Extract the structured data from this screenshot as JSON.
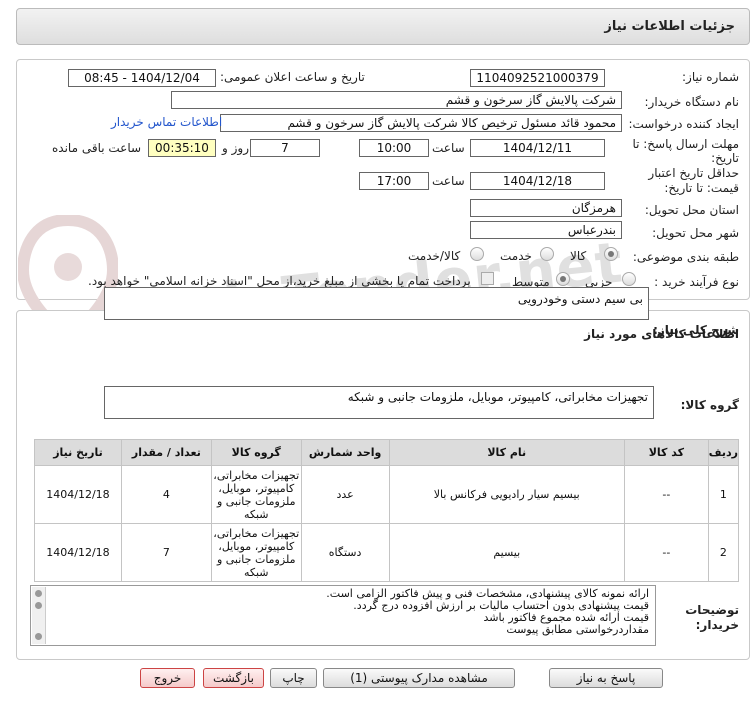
{
  "header": {
    "title": "جزئیات اطلاعات نیاز"
  },
  "watermark": "AriaTender.net",
  "info": {
    "need_number_label": "شماره نیاز:",
    "need_number": "1104092521000379",
    "announce_label": "تاریخ و ساعت اعلان عمومی:",
    "announce_value": "1404/12/04 - 08:45",
    "buyer_org_label": "نام دستگاه خریدار:",
    "buyer_org": "شرکت پالایش گاز سرخون و قشم",
    "creator_label": "ایجاد کننده درخواست:",
    "creator": "محمود قائد مسئول ترخیص کالا شرکت پالایش گاز سرخون و قشم",
    "contact_link": "اطلاعات تماس خریدار",
    "deadline_label_1": "مهلت ارسال پاسخ: تا",
    "deadline_label_2": "تاریخ:",
    "deadline_date": "1404/12/11",
    "time_label": "ساعت",
    "deadline_time": "10:00",
    "days_value": "7",
    "days_label": "روز و",
    "remaining_time": "00:35:10",
    "remaining_label": "ساعت باقی مانده",
    "validity_label_1": "حداقل تاریخ اعتبار",
    "validity_label_2": "قیمت: تا تاریخ:",
    "validity_date": "1404/12/18",
    "validity_time": "17:00",
    "province_label": "استان محل تحویل:",
    "province": "هرمزگان",
    "city_label": "شهر محل تحویل:",
    "city": "بندرعباس",
    "category_label": "طبقه بندی موضوعی:",
    "category_options": [
      "کالا",
      "خدمت",
      "کالا/خدمت"
    ],
    "category_selected": "کالا",
    "process_label": "نوع فرآیند خرید :",
    "process_options": [
      "جزیی",
      "متوسط"
    ],
    "payment_note": "پرداخت تمام یا بخشی از مبلغ خرید،از محل \"اسناد خزانه اسلامی\" خواهد بود."
  },
  "description": {
    "label": "شرح کلی نیاز:",
    "value": "بی سیم دستی وخودرویی"
  },
  "goods": {
    "section_title": "اطلاعات کالاهای مورد نیاز",
    "group_label": "گروه کالا:",
    "group_value": "تجهیزات مخابراتی، کامپیوتر، موبایل، ملزومات جانبی و شبکه",
    "columns": [
      "ردیف",
      "کد کالا",
      "نام کالا",
      "واحد شمارش",
      "گروه کالا",
      "تعداد / مقدار",
      "تاریخ نیاز"
    ],
    "rows": [
      {
        "row": "1",
        "code": "--",
        "name": "بیسیم سیار رادیویی فرکانس بالا",
        "unit": "عدد",
        "group_lines": [
          "تجهیزات مخابراتی،",
          "کامپیوتر، موبایل،",
          "ملزومات جانبی و",
          "شبکه"
        ],
        "qty": "4",
        "date": "1404/12/18"
      },
      {
        "row": "2",
        "code": "--",
        "name": "بیسیم",
        "unit": "دستگاه",
        "group_lines": [
          "تجهیزات مخابراتی،",
          "کامپیوتر، موبایل،",
          "ملزومات جانبی و",
          "شبکه"
        ],
        "qty": "7",
        "date": "1404/12/18"
      }
    ]
  },
  "buyer_notes": {
    "label_1": "توضیحات",
    "label_2": "خریدار:",
    "lines": [
      "ارائه نمونه کالای پیشنهادی، مشخصات فنی و پیش فاکتور الزامی است.",
      "قیمت پیشنهادی بدون احتساب مالیات بر ارزش افزوده درج گردد.",
      "قیمت ارائه شده مجموع فاکتور باشد",
      "مقداردرخواستی مطابق پیوست"
    ]
  },
  "buttons": {
    "reply": "پاسخ به نیاز",
    "docs": "مشاهده مدارک پیوستی (1)",
    "print": "چاپ",
    "back": "بازگشت",
    "exit": "خروج"
  }
}
